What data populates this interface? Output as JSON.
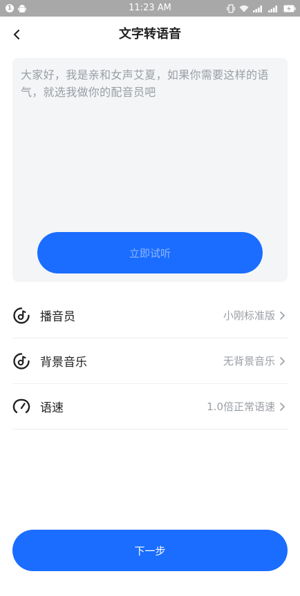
{
  "status_bar": {
    "time": "11:23 AM",
    "left_badge": "1"
  },
  "header": {
    "title": "文字转语音"
  },
  "editor": {
    "text": "大家好，我是亲和女声艾夏，如果你需要这样的语气，就选我做你的配音员吧",
    "listen_label": "立即试听"
  },
  "settings": [
    {
      "label": "播音员",
      "value": "小刚标准版",
      "icon": "disc-note-icon"
    },
    {
      "label": "背景音乐",
      "value": "无背景音乐",
      "icon": "disc-note-icon"
    },
    {
      "label": "语速",
      "value": "1.0倍正常语速",
      "icon": "speedometer-icon"
    }
  ],
  "footer": {
    "next_label": "下一步"
  },
  "colors": {
    "accent": "#1a6dff",
    "status_bar": "#a8a8a8",
    "panel_bg": "#f3f5f7",
    "muted_text": "#9a9ea4"
  }
}
